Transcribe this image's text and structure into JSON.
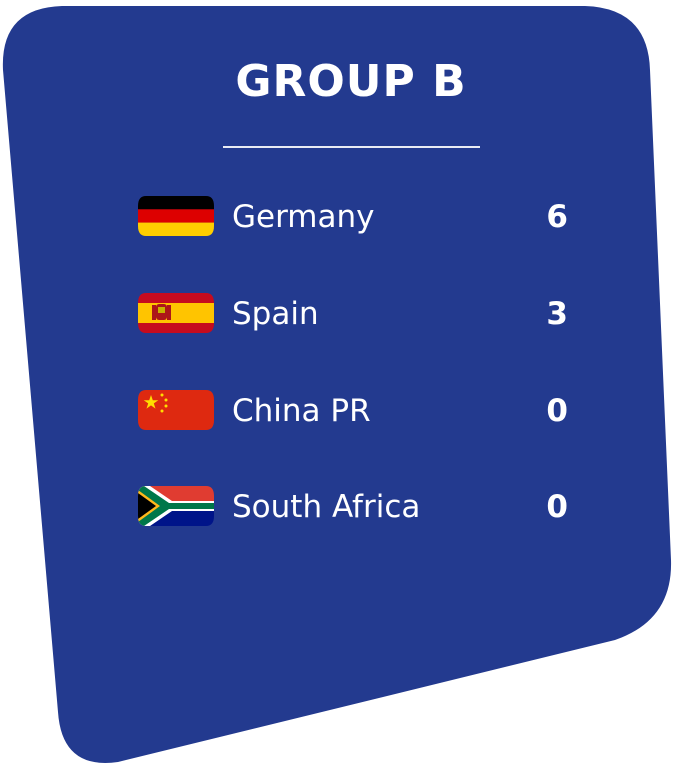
{
  "group": {
    "title": "GROUP B",
    "background_color": "#233A8F"
  },
  "standings": [
    {
      "team": "Germany",
      "points": "6",
      "flag_icon": "germany-flag-icon"
    },
    {
      "team": "Spain",
      "points": "3",
      "flag_icon": "spain-flag-icon"
    },
    {
      "team": "China PR",
      "points": "0",
      "flag_icon": "china-flag-icon"
    },
    {
      "team": "South Africa",
      "points": "0",
      "flag_icon": "south-africa-flag-icon"
    }
  ]
}
